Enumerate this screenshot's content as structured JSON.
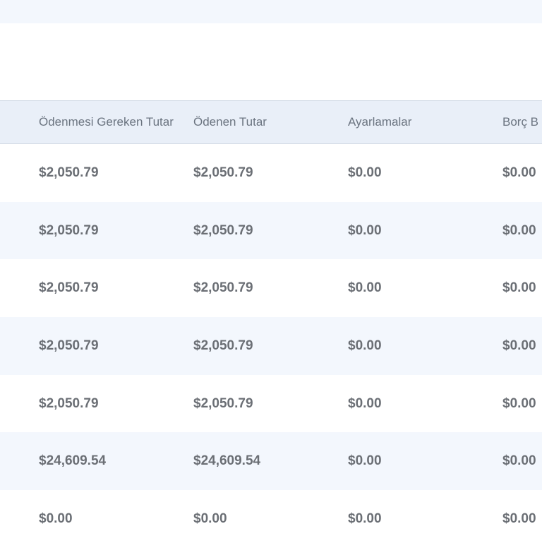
{
  "table": {
    "columns": [
      "Ödenmesi Gereken Tutar",
      "Ödenen Tutar",
      "Ayarlamalar",
      "Borç B"
    ],
    "rows": [
      [
        "$2,050.79",
        "$2,050.79",
        "$0.00",
        "$0.00"
      ],
      [
        "$2,050.79",
        "$2,050.79",
        "$0.00",
        "$0.00"
      ],
      [
        "$2,050.79",
        "$2,050.79",
        "$0.00",
        "$0.00"
      ],
      [
        "$2,050.79",
        "$2,050.79",
        "$0.00",
        "$0.00"
      ],
      [
        "$2,050.79",
        "$2,050.79",
        "$0.00",
        "$0.00"
      ],
      [
        "$24,609.54",
        "$24,609.54",
        "$0.00",
        "$0.00"
      ],
      [
        "$0.00",
        "$0.00",
        "$0.00",
        "$0.00"
      ]
    ]
  },
  "colors": {
    "header_bg": "#e9eff8",
    "alt_row_bg": "#f3f7fd",
    "text": "#6b6f75"
  }
}
